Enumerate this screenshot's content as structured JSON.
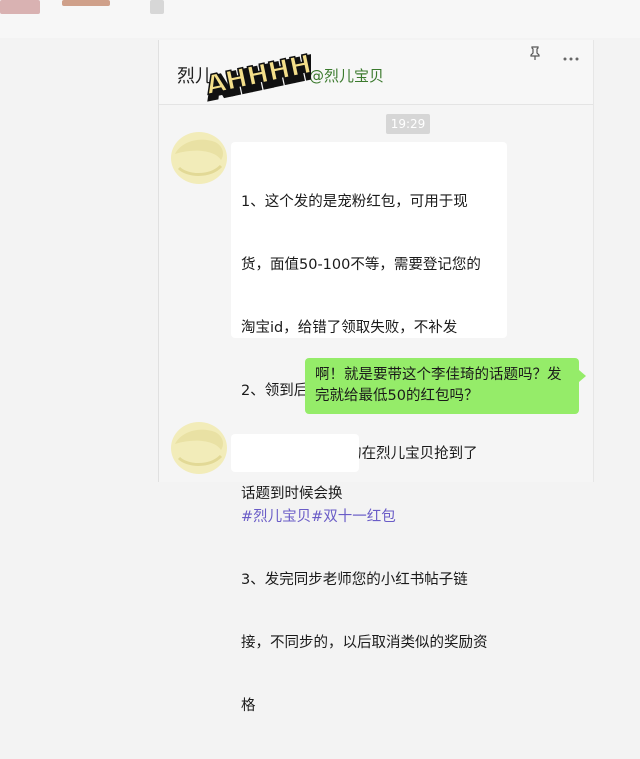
{
  "header": {
    "title": "烈儿",
    "handle": "@烈儿宝贝",
    "sticker_text": "AHHHH!",
    "pin_icon": "pin-icon",
    "more_icon": "more-icon"
  },
  "timestamp": "19:29",
  "messages": [
    {
      "sender": "other",
      "lines": [
        "1、这个发的是宠粉红包，可用于现",
        "货，面值50-100不等，需要登记您的",
        "淘宝id，给错了领取失败，不补发",
        "2、领到后，第一时间，发小红书：标",
        "题 没抢到李佳琦的在烈儿宝贝抢到了"
      ],
      "tags": "#烈儿宝贝#双十一红包",
      "lines_after": [
        "3、发完同步老师您的小红书帖子链",
        "接，不同步的，以后取消类似的奖励资",
        "格"
      ]
    },
    {
      "sender": "self",
      "lines": [
        "啊！就是要带这个李佳琦的话题吗？发",
        "完就给最低50的红包吗？"
      ]
    },
    {
      "sender": "other",
      "lines": [
        "话题到时候会换"
      ]
    }
  ],
  "colors": {
    "self_bubble": "#95ec69",
    "tag": "#6a5cc7",
    "handle": "#3b7a2d"
  }
}
